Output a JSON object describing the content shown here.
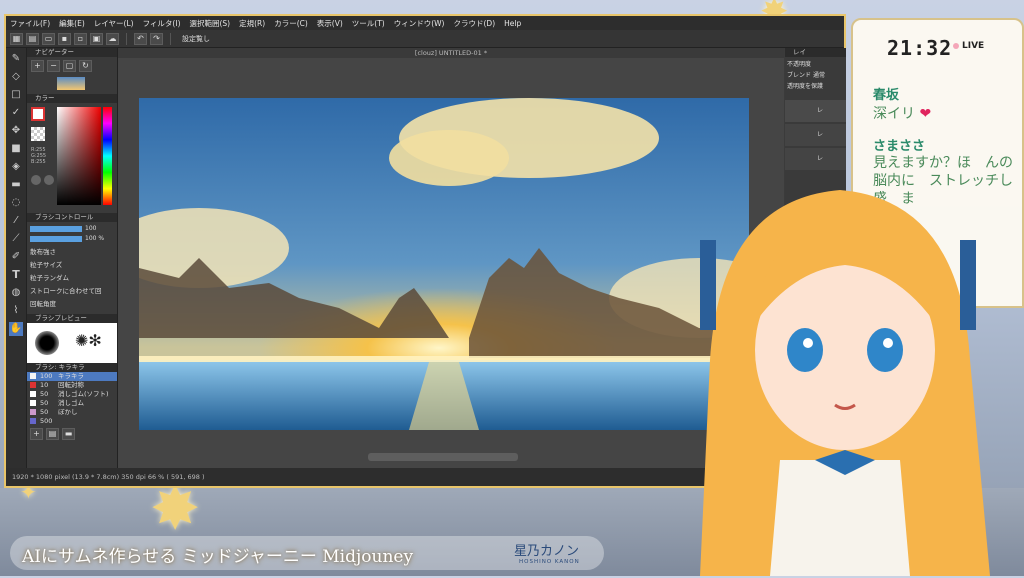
{
  "menu": [
    "ファイル(F)",
    "編集(E)",
    "レイヤー(L)",
    "フィルタ(I)",
    "選択範囲(S)",
    "定規(R)",
    "カラー(C)",
    "表示(V)",
    "ツール(T)",
    "ウィンドウ(W)",
    "クラウド(D)",
    "Help"
  ],
  "command_bar": {
    "deselect_label": "設定覧し"
  },
  "document_tab": "[clouz] UNTITLED-01 *",
  "navigator": {
    "title": "ナビゲーター"
  },
  "color_panel": {
    "title": "カラー",
    "labels": [
      "R:255",
      "G:255",
      "B:255"
    ]
  },
  "brush_control": {
    "title": "ブラシコントロール",
    "size_value": "100",
    "opacity_value": "100 %",
    "params": [
      "散布強さ",
      "粒子サイズ",
      "粒子ランダム",
      "ストロークに合わせて回",
      "回転角度"
    ]
  },
  "brush_preview": {
    "title": "ブラシプレビュー"
  },
  "brush_list": {
    "title": "ブラシ: キラキラ",
    "items": [
      {
        "size": "100",
        "name": "キラキラ",
        "color": "#f5f5f5",
        "active": true
      },
      {
        "size": "10",
        "name": "回転対称",
        "color": "#d33",
        "active": false
      },
      {
        "size": "50",
        "name": "消しゴム(ソフト)",
        "color": "#fff",
        "active": false
      },
      {
        "size": "50",
        "name": "消しゴム",
        "color": "#fff",
        "active": false
      },
      {
        "size": "50",
        "name": "ぼかし",
        "color": "#c9c",
        "active": false
      },
      {
        "size": "500",
        "name": "",
        "color": "#66c",
        "active": false
      }
    ]
  },
  "layer_panel": {
    "title": "レイ",
    "opacity_label": "不透明度",
    "blend_label": "ブレンド",
    "blend_value": "通常",
    "protect_label": "透明度を保護",
    "layers": [
      "レ",
      "レ",
      "レ"
    ]
  },
  "status": "1920 * 1080 pixel   (13.9 * 7.8cm)   350 dpi   66 %   ( 591, 698 )",
  "chat": {
    "time": "21:32",
    "live_label": "LIVE",
    "messages": [
      {
        "name": "春坂",
        "text": "深イリ"
      },
      {
        "name": "さまささ",
        "text": "見えますか？ほ　んの脳内に　ストレッチし　　盛　ま"
      }
    ]
  },
  "banner": {
    "title": "AIにサムネ作らせる ミッドジャーニー Midjouney",
    "logo": "星乃カノン",
    "logo_sub": "HOSHINO KANON"
  },
  "colors": {
    "accent": "#4d7ac0",
    "frame": "#e8c56a",
    "panel": "#3a3a3a",
    "chat_name": "#2a8a6a"
  }
}
